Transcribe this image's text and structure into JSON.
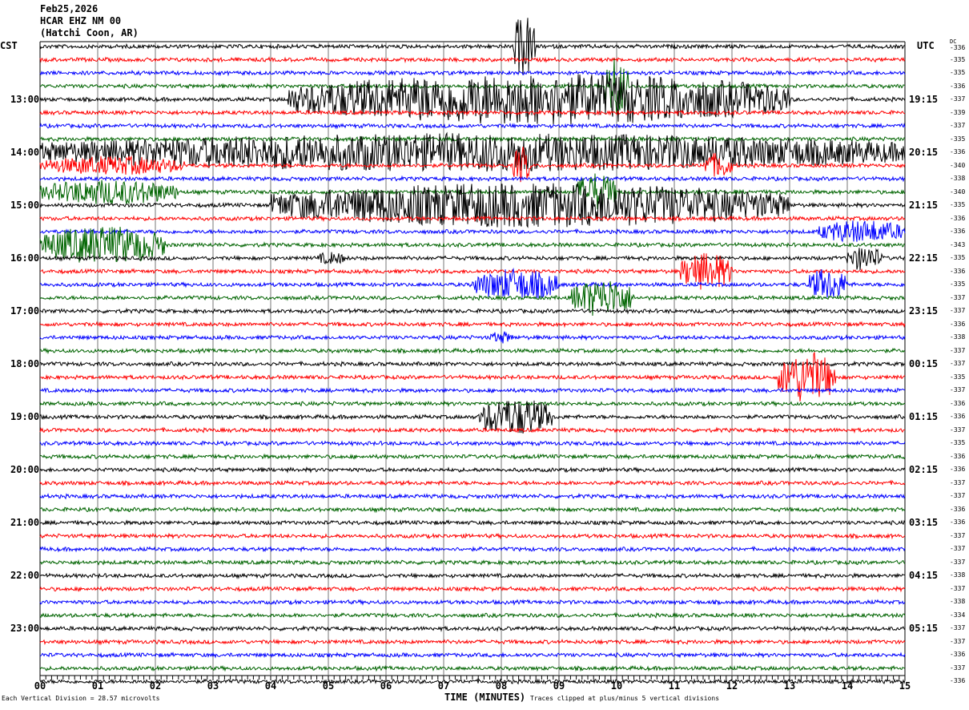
{
  "header": {
    "date": "Feb25,2026",
    "station": "HCAR EHZ NM 00",
    "location": "(Hatchi Coon, AR)"
  },
  "left_tz": "CST",
  "right_tz": "UTC",
  "dc_label": "DC",
  "footer": {
    "division": "Each Vertical Division =   28.57 microvolts",
    "xlabel": "TIME (MINUTES)",
    "clip_note": "Traces clipped at plus/minus 5 vertical divisions"
  },
  "chart_data": {
    "type": "line",
    "title": "Feb25,2026 HCAR EHZ NM 00 (Hatchi Coon, AR)",
    "xlabel": "TIME (MINUTES)",
    "xlim": [
      0,
      15
    ],
    "x_ticks": [
      "00",
      "01",
      "02",
      "03",
      "04",
      "05",
      "06",
      "07",
      "08",
      "09",
      "10",
      "11",
      "12",
      "13",
      "14",
      "15"
    ],
    "trace_colors": [
      "#000000",
      "#ff0000",
      "#0000ff",
      "#006400"
    ],
    "left_hour_labels": [
      "13:00",
      "14:00",
      "15:00",
      "16:00",
      "17:00",
      "18:00",
      "19:00",
      "20:00",
      "21:00",
      "22:00",
      "23:00"
    ],
    "right_hour_labels": [
      "19:15",
      "20:15",
      "21:15",
      "22:15",
      "23:15",
      "00:15",
      "01:15",
      "02:15",
      "03:15",
      "04:15",
      "05:15"
    ],
    "dc_offsets": [
      -336,
      -335,
      -335,
      -336,
      -337,
      -339,
      -337,
      -335,
      -336,
      -340,
      -338,
      -340,
      -335,
      -336,
      -336,
      -343,
      -335,
      -336,
      -335,
      -337,
      -337,
      -336,
      -338,
      -337,
      -337,
      -335,
      -337,
      -336,
      -336,
      -337,
      -335,
      -336,
      -336,
      -337,
      -337,
      -336,
      -336,
      -337,
      -337,
      -337,
      -338,
      -337,
      -338,
      -334,
      -337,
      -337,
      -336,
      -337,
      -336
    ],
    "clip_divisions": 5,
    "events": [
      {
        "trace": 4,
        "start_min": 4.3,
        "end_min": 13.0,
        "amp_div": 4
      },
      {
        "trace": 8,
        "start_min": 0.0,
        "end_min": 15.0,
        "amp_div": 3
      },
      {
        "trace": 12,
        "start_min": 4.0,
        "end_min": 13.0,
        "amp_div": 3.5
      },
      {
        "trace": 0,
        "start_min": 8.2,
        "end_min": 8.6,
        "amp_div": 5
      },
      {
        "trace": 3,
        "start_min": 9.8,
        "end_min": 10.2,
        "amp_div": 5
      },
      {
        "trace": 9,
        "start_min": 0.0,
        "end_min": 2.5,
        "amp_div": 1.5
      },
      {
        "trace": 9,
        "start_min": 8.2,
        "end_min": 8.5,
        "amp_div": 3
      },
      {
        "trace": 9,
        "start_min": 11.5,
        "end_min": 12.0,
        "amp_div": 2
      },
      {
        "trace": 11,
        "start_min": 0.0,
        "end_min": 2.4,
        "amp_div": 2
      },
      {
        "trace": 11,
        "start_min": 9.3,
        "end_min": 10.0,
        "amp_div": 3
      },
      {
        "trace": 14,
        "start_min": 13.5,
        "end_min": 15.0,
        "amp_div": 1.8
      },
      {
        "trace": 15,
        "start_min": 0.0,
        "end_min": 2.2,
        "amp_div": 3
      },
      {
        "trace": 16,
        "start_min": 4.8,
        "end_min": 5.3,
        "amp_div": 1
      },
      {
        "trace": 16,
        "start_min": 14.0,
        "end_min": 14.6,
        "amp_div": 2
      },
      {
        "trace": 17,
        "start_min": 11.1,
        "end_min": 12.0,
        "amp_div": 3
      },
      {
        "trace": 18,
        "start_min": 7.5,
        "end_min": 9.0,
        "amp_div": 2.5
      },
      {
        "trace": 18,
        "start_min": 13.3,
        "end_min": 14.0,
        "amp_div": 2.5
      },
      {
        "trace": 19,
        "start_min": 9.2,
        "end_min": 10.3,
        "amp_div": 3
      },
      {
        "trace": 22,
        "start_min": 7.8,
        "end_min": 8.2,
        "amp_div": 1
      },
      {
        "trace": 25,
        "start_min": 12.8,
        "end_min": 13.8,
        "amp_div": 4
      },
      {
        "trace": 28,
        "start_min": 7.6,
        "end_min": 8.9,
        "amp_div": 3
      }
    ]
  }
}
